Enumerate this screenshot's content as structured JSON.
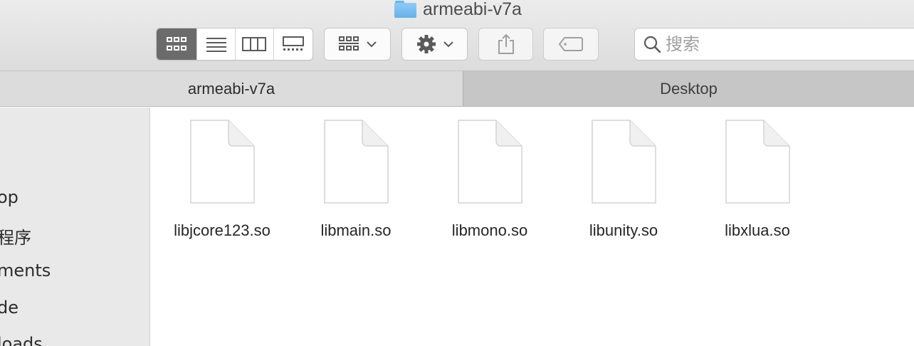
{
  "window": {
    "title": "armeabi-v7a",
    "title_icon": "folder-icon"
  },
  "toolbar": {
    "view_modes": [
      {
        "name": "icon-view",
        "icon": "grid-icon",
        "active": true
      },
      {
        "name": "list-view",
        "icon": "list-icon",
        "active": false
      },
      {
        "name": "column-view",
        "icon": "columns-icon",
        "active": false
      },
      {
        "name": "gallery-view",
        "icon": "gallery-icon",
        "active": false
      }
    ],
    "group_by_icon": "group-grid-icon",
    "action_icon": "gear-icon",
    "share_icon": "share-icon",
    "tags_icon": "tag-icon",
    "search": {
      "placeholder": "搜索",
      "value": "",
      "icon": "search-icon"
    }
  },
  "tabs": [
    {
      "label": "armeabi-v7a",
      "active": true
    },
    {
      "label": "Desktop",
      "active": false
    }
  ],
  "sidebar": {
    "items": [
      {
        "label": "op"
      },
      {
        "label": "程序"
      },
      {
        "label": "ments"
      },
      {
        "label": "de"
      },
      {
        "label": "loads"
      }
    ]
  },
  "files": [
    {
      "name": "libjcore123.so",
      "icon": "document-icon"
    },
    {
      "name": "libmain.so",
      "icon": "document-icon"
    },
    {
      "name": "libmono.so",
      "icon": "document-icon"
    },
    {
      "name": "libunity.so",
      "icon": "document-icon"
    },
    {
      "name": "libxlua.so",
      "icon": "document-icon"
    }
  ],
  "colors": {
    "active_segment": "#6b6b6b",
    "folder_blue": "#65b0ea"
  }
}
